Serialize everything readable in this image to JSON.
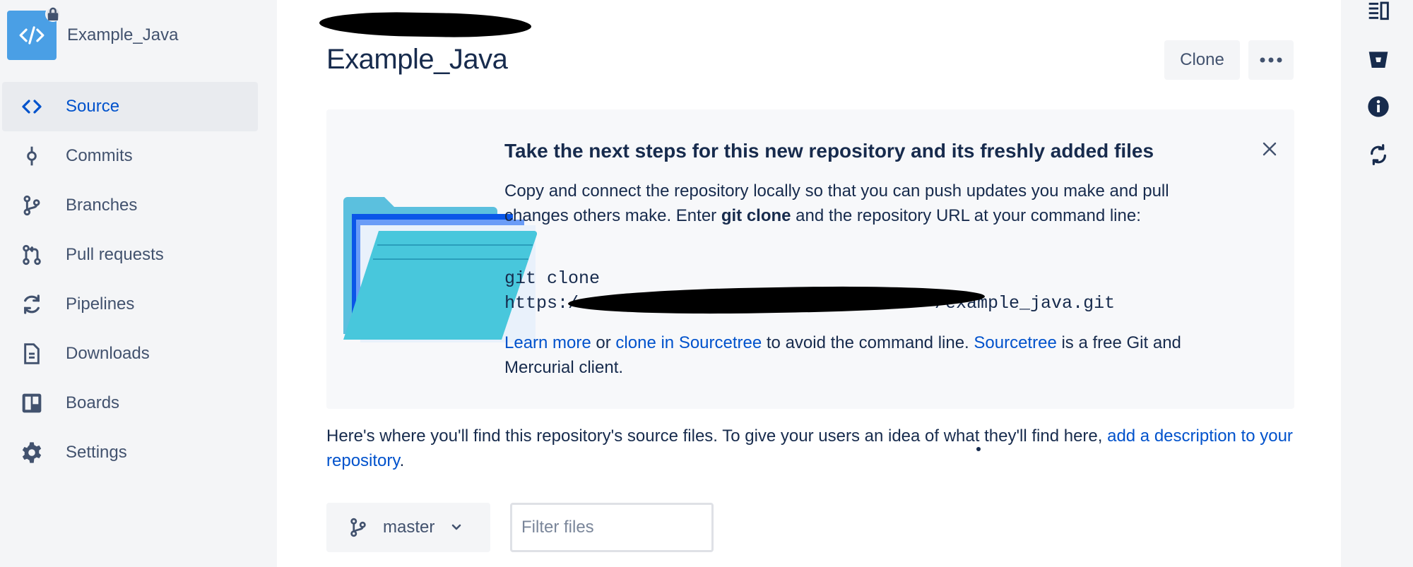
{
  "sidebar": {
    "repo_name": "Example_Java",
    "items": [
      {
        "label": "Source",
        "icon": "code-icon",
        "active": true
      },
      {
        "label": "Commits",
        "icon": "commit-icon",
        "active": false
      },
      {
        "label": "Branches",
        "icon": "branch-icon",
        "active": false
      },
      {
        "label": "Pull requests",
        "icon": "pull-request-icon",
        "active": false
      },
      {
        "label": "Pipelines",
        "icon": "pipelines-icon",
        "active": false
      },
      {
        "label": "Downloads",
        "icon": "downloads-icon",
        "active": false
      },
      {
        "label": "Boards",
        "icon": "boards-icon",
        "active": false
      },
      {
        "label": "Settings",
        "icon": "gear-icon",
        "active": false
      }
    ]
  },
  "header": {
    "title": "Example_Java",
    "clone_label": "Clone",
    "more_icon": "more-icon"
  },
  "banner": {
    "title": "Take the next steps for this new repository and its freshly added files",
    "text_pre": "Copy and connect the repository locally so that you can push updates you make and pull changes others make. Enter ",
    "text_bold": "git clone",
    "text_post": " and the repository URL at your command line:",
    "code_line1": "git clone",
    "code_line2_start": "https:/",
    "code_line2_end": "/example_java.git",
    "learn_more": "Learn more",
    "or": " or ",
    "clone_sourcetree": "clone in Sourcetree",
    "mid_text": " to avoid the command line. ",
    "sourcetree": "Sourcetree",
    "end_text": " is a free Git and Mercurial client."
  },
  "description": {
    "text": "Here's where you'll find this repository's source files. To give your users an idea of what they'll find here, ",
    "link": "add a description to your repository",
    "end": "."
  },
  "toolbar": {
    "branch": "master",
    "filter_placeholder": "Filter files"
  },
  "colors": {
    "accent": "#0052cc",
    "sidebar_bg": "#f4f5f7",
    "text": "#172b4d",
    "avatar": "#4a9fe5"
  }
}
